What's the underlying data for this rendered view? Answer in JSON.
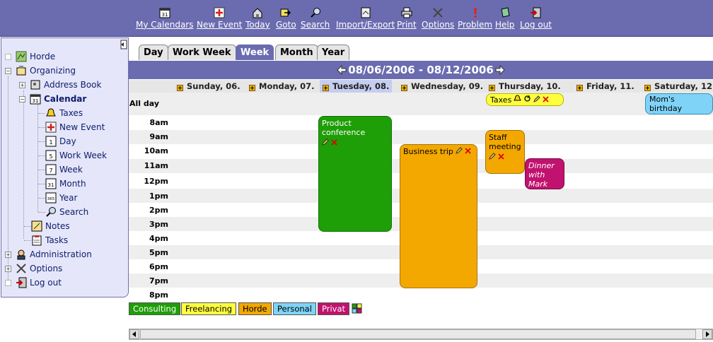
{
  "toolbar": {
    "items": [
      {
        "label": "My Calendars",
        "icon": "calendar-icon"
      },
      {
        "label": "New Event",
        "icon": "new-event-icon"
      },
      {
        "label": "Today",
        "icon": "home-icon"
      },
      {
        "label": "Goto",
        "icon": "goto-icon"
      },
      {
        "label": "Search",
        "icon": "search-icon"
      },
      {
        "label": "Import/Export",
        "icon": "import-export-icon"
      },
      {
        "label": "Print",
        "icon": "print-icon"
      },
      {
        "label": "Options",
        "icon": "options-icon"
      },
      {
        "label": "Problem",
        "icon": "problem-icon"
      },
      {
        "label": "Help",
        "icon": "help-icon"
      },
      {
        "label": "Log out",
        "icon": "logout-icon"
      }
    ]
  },
  "sidebar": {
    "items": [
      {
        "label": "Horde",
        "icon": "horde-icon"
      },
      {
        "label": "Organizing",
        "icon": "organizing-icon"
      },
      {
        "label": "Address Book",
        "icon": "address-book-icon"
      },
      {
        "label": "Calendar",
        "icon": "calendar-icon"
      },
      {
        "label": "Taxes",
        "icon": "bell-icon"
      },
      {
        "label": "New Event",
        "icon": "new-event-icon"
      },
      {
        "label": "Day",
        "icon": "day-icon",
        "badge": "1"
      },
      {
        "label": "Work Week",
        "icon": "work-week-icon",
        "badge": "5"
      },
      {
        "label": "Week",
        "icon": "week-icon",
        "badge": "7"
      },
      {
        "label": "Month",
        "icon": "month-icon",
        "badge": "31"
      },
      {
        "label": "Year",
        "icon": "year-icon",
        "badge": "365"
      },
      {
        "label": "Search",
        "icon": "search-icon"
      },
      {
        "label": "Notes",
        "icon": "notes-icon"
      },
      {
        "label": "Tasks",
        "icon": "tasks-icon"
      },
      {
        "label": "Administration",
        "icon": "administration-icon"
      },
      {
        "label": "Options",
        "icon": "options-icon"
      },
      {
        "label": "Log out",
        "icon": "logout-icon"
      }
    ]
  },
  "tabs": [
    "Day",
    "Work Week",
    "Week",
    "Month",
    "Year"
  ],
  "active_tab": "Week",
  "date_range": "08/06/2006 - 08/12/2006",
  "days": [
    "Sunday, 06.",
    "Monday, 07.",
    "Tuesday, 08.",
    "Wednesday, 09.",
    "Thursday, 10.",
    "Friday, 11.",
    "Saturday, 12."
  ],
  "today_index": 2,
  "allday_label": "All day",
  "hours": [
    "8am",
    "9am",
    "10am",
    "11am",
    "12pm",
    "1pm",
    "2pm",
    "3pm",
    "4pm",
    "5pm",
    "6pm",
    "7pm",
    "8pm"
  ],
  "events": {
    "product_conference": "Product conference",
    "business_trip": "Business trip",
    "staff_meeting": "Staff meeting",
    "dinner": "Dinner with Mark",
    "taxes": "Taxes",
    "birthday": "Mom's birthday"
  },
  "legend": [
    {
      "label": "Consulting",
      "color": "#1e9e07"
    },
    {
      "label": "Freelancing",
      "color": "#ffff40"
    },
    {
      "label": "Horde",
      "color": "#f3a800"
    },
    {
      "label": "Personal",
      "color": "#7fd3f7"
    },
    {
      "label": "Privat",
      "color": "#c0126e"
    }
  ],
  "colors": {
    "header": "#6b6bb0",
    "sidebar_bg": "#e6e6fa",
    "today_highlight": "#c5cdf0"
  }
}
